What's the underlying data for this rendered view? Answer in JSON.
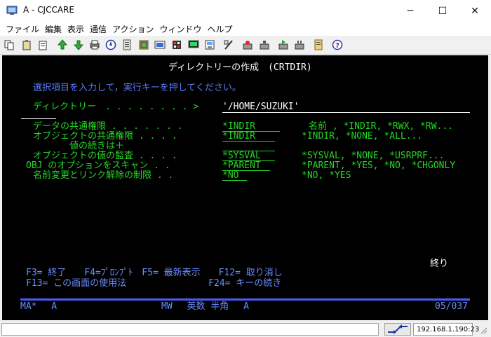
{
  "window": {
    "title": "A - CJCCARE",
    "minimize": "─",
    "maximize": "☐",
    "close": "✕"
  },
  "menu": {
    "items": [
      "ファイル",
      "編集",
      "表示",
      "通信",
      "アクション",
      "ウィンドウ",
      "ヘルプ"
    ]
  },
  "toolbar": {
    "buttons": [
      "copy-icon",
      "paste-icon",
      "clipboard-icon",
      "upload-icon",
      "download-icon",
      "print-icon",
      "compass-icon",
      "page-icon",
      "stack-icon",
      "macro-icon",
      "keypad-icon",
      "display-icon",
      "disk-icon",
      "keyboard-icon",
      "record-icon",
      "stop-icon",
      "play-icon",
      "pause-icon",
      "note-icon",
      "help-icon"
    ]
  },
  "screen": {
    "title": "ディレクトリーの作成　(CRTDIR)",
    "instruction": "選択項目を入力して，実行キーを押してください。",
    "dir_label": "ディレクトリー　. . . . . . . . >",
    "dir_value": "'/HOME/SUZUKI'",
    "rows": [
      {
        "label": "データの共通権限 . . . . . . .",
        "value": "*INDIR",
        "choices": "名前 , *INDIR, *RWX, *RW..."
      },
      {
        "label": "オブジェクトの共通権限 . . . .",
        "value": "*INDIR",
        "choices": "*INDIR, *NONE, *ALL..."
      },
      {
        "label": "　　　　値の続きは＋",
        "value": "",
        "choices": ""
      },
      {
        "label": "オブジェクトの値の監査 . . . .",
        "value": "*SYSVAL",
        "choices": "*SYSVAL, *NONE, *USRPRF..."
      },
      {
        "label": "OBJ のオプションをスキャン . .",
        "value": "*PARENT",
        "choices": "*PARENT, *YES, *NO, *CHGONLY"
      },
      {
        "label": "名前変更とリンク解除の制限 . .",
        "value": "*NO",
        "choices": "*NO, *YES"
      }
    ],
    "end_label": "終り",
    "fkeys_line1": "F3= 終了　　F4=ﾌﾟﾛﾝﾌﾟﾄ　F5= 最新表示　　F12= 取り消し",
    "fkeys_line2": "F13= この画面の使用法　　　　　　　　　F24= キーの続き",
    "oia": {
      "left": "MA*　 A",
      "mid": "MW　 英数 半角　 A",
      "pos": "05/037"
    }
  },
  "statusbar": {
    "ip": "192.168.1.190:23"
  }
}
